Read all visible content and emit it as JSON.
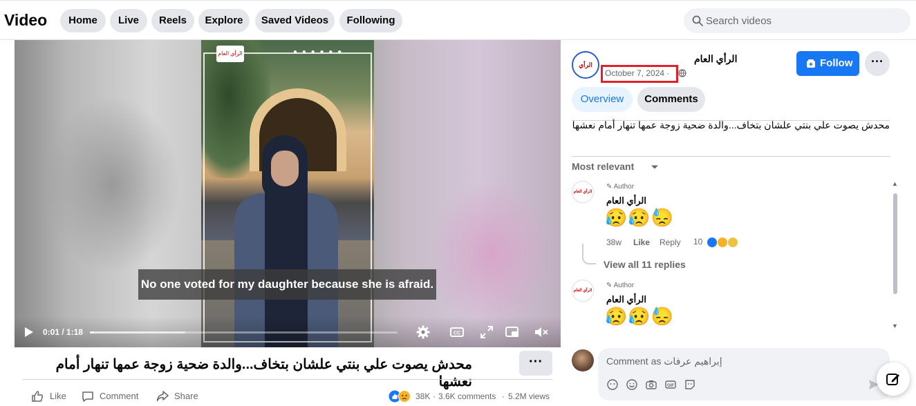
{
  "header": {
    "title": "Video",
    "nav": [
      "Home",
      "Live",
      "Reels",
      "Explore",
      "Saved Videos",
      "Following"
    ],
    "search_placeholder": "Search videos"
  },
  "player": {
    "overlay_logo": "الرأي العام",
    "caption": "No one voted for my daughter because she is afraid.",
    "time": "0:01 / 1:18",
    "progress_fraction": 0.013,
    "buffered_fraction": 0.31,
    "controls": [
      "play-icon",
      "settings-icon",
      "captions-icon",
      "fullscreen-icon",
      "pip-icon",
      "mute-icon"
    ]
  },
  "video_info": {
    "title": "محدش يصوت علي بنتي علشان بتخاف...والدة ضحية زوجة عمها تنهار أمام نعشها",
    "actions": {
      "like": "Like",
      "comment": "Comment",
      "share": "Share"
    },
    "stats": {
      "reactions": "38K",
      "comments": "3.6K comments",
      "views": "5.2M views",
      "sep": "·"
    }
  },
  "sidebar": {
    "page_name": "الرأي العام",
    "avatar_text": "الرأي العام",
    "date": "October 7, 2024 ·",
    "follow_label": "Follow",
    "tabs": {
      "overview": "Overview",
      "comments": "Comments"
    },
    "description": "محدش يصوت علي بنتي علشان بتخاف...والدة ضحية زوجة عمها تنهار أمام نعشها",
    "sort_label": "Most relevant",
    "comments": [
      {
        "badge": "✎ Author",
        "name": "الرأي العام",
        "emoji": "😥😥😓",
        "time": "38w",
        "like": "Like",
        "reply": "Reply",
        "reaction_count": "10",
        "replies_label": "View all 11 replies"
      },
      {
        "badge": "✎ Author",
        "name": "الرأي العام",
        "emoji": "😥😥😓"
      }
    ],
    "comment_placeholder": "Comment as إبراهيم عرفات"
  },
  "colors": {
    "accent": "#1877f2",
    "highlight_box": "#e0202b",
    "pill_bg": "#e4e6eb",
    "muted_text": "#65676b"
  }
}
